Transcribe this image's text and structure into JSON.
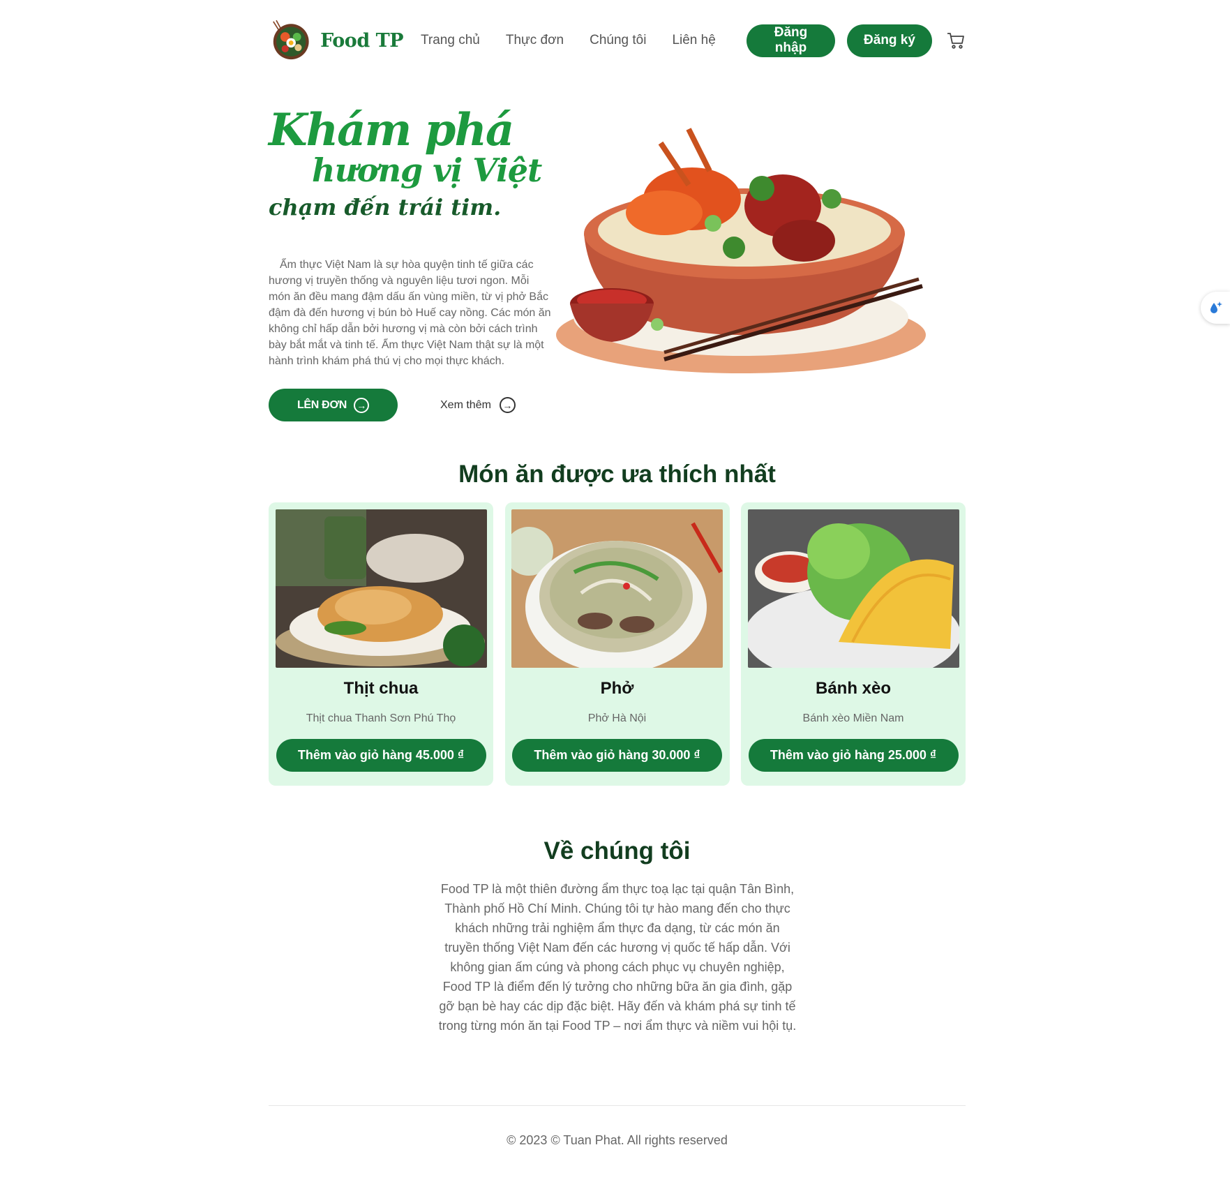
{
  "header": {
    "brand": "Food TP",
    "nav": [
      "Trang chủ",
      "Thực đơn",
      "Chúng tôi",
      "Liên hệ"
    ],
    "login_label": "Đăng nhập",
    "register_label": "Đăng ký",
    "icons": {
      "cart": "cart-icon",
      "logo": "food-bowl-logo"
    }
  },
  "hero": {
    "title_line1": "Khám phá",
    "title_line2": "hương vị Việt",
    "title_line3": "chạm đến trái tim.",
    "description": "Ẩm thực Việt Nam là sự hòa quyện tinh tế giữa các hương vị truyền thống và nguyên liệu tươi ngon. Mỗi món ăn đều mang đậm dấu ấn vùng miền, từ vị phở Bắc đậm đà đến hương vị bún bò Huế cay nồng. Các món ăn không chỉ hấp dẫn bởi hương vị mà còn bởi cách trình bày bắt mắt và tinh tế. Ẩm thực Việt Nam thật sự là một hành trình khám phá thú vị cho mọi thực khách.",
    "order_label": "LÊN ĐƠN",
    "see_more_label": "Xem thêm"
  },
  "popular": {
    "title": "Món ăn được ưa thích nhất",
    "items": [
      {
        "name": "Thịt chua",
        "desc": "Thịt chua Thanh Sơn Phú Thọ",
        "btn": "Thêm vào giỏ hàng",
        "price": "45.000 ₫"
      },
      {
        "name": "Phở",
        "desc": "Phở Hà Nội",
        "btn": "Thêm vào giỏ hàng",
        "price": "30.000 ₫"
      },
      {
        "name": "Bánh xèo",
        "desc": "Bánh xèo Miền Nam",
        "btn": "Thêm vào giỏ hàng",
        "price": "25.000 ₫"
      }
    ]
  },
  "about": {
    "title": "Về chúng tôi",
    "text": "Food TP là một thiên đường ẩm thực toạ lạc tại quận Tân Bình, Thành phố Hồ Chí Minh. Chúng tôi tự hào mang đến cho thực khách những trải nghiệm ẩm thực đa dạng, từ các món ăn truyền thống Việt Nam đến các hương vị quốc tế hấp dẫn. Với không gian ấm cúng và phong cách phục vụ chuyên nghiệp, Food TP là điểm đến lý tưởng cho những bữa ăn gia đình, gặp gỡ bạn bè hay các dịp đặc biệt. Hãy đến và khám phá sự tinh tế trong từng món ăn tại Food TP – nơi ẩm thực và niềm vui hội tụ."
  },
  "footer": {
    "text": "© 2023 © Tuan Phat. All rights reserved"
  },
  "colors": {
    "primary": "#157a3b",
    "title_green": "#1d9a3f",
    "card_bg": "#def8e6",
    "heading": "#123d1f"
  }
}
